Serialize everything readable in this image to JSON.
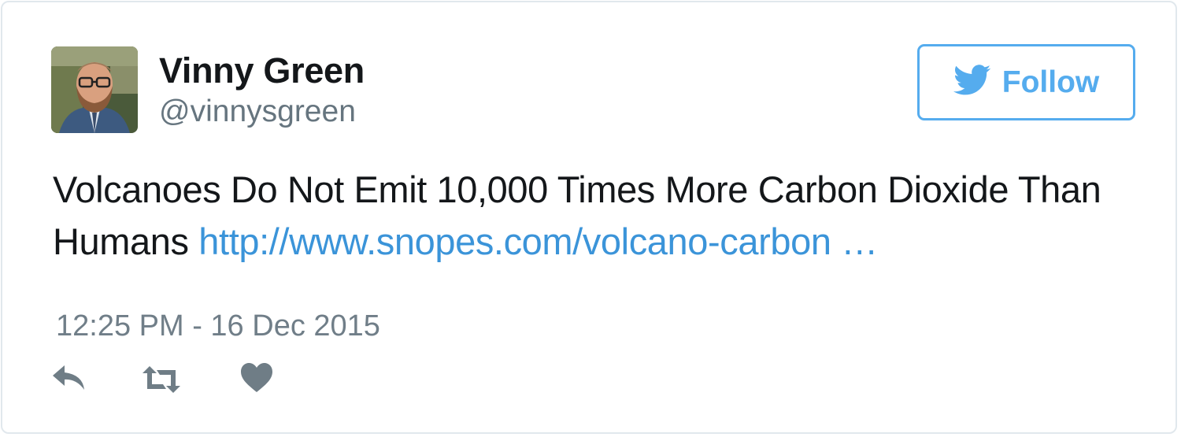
{
  "tweet": {
    "author_name": "Vinny Green",
    "author_handle": "@vinnysgreen",
    "follow_label": "Follow",
    "text": "Volcanoes Do Not Emit 10,000 Times More Carbon Dioxide Than Humans",
    "link_text": "http://www.snopes.com/volcano-carbon …",
    "timestamp": "12:25 PM - 16 Dec 2015"
  },
  "icons": {
    "follow": "twitter-bird-icon",
    "reply": "reply-icon",
    "retweet": "retweet-icon",
    "like": "heart-icon"
  },
  "colors": {
    "twitter_blue": "#55acee",
    "link_blue": "#3b94d9",
    "text_dark": "#14171a",
    "text_muted": "#66757f",
    "icon_gray": "#6f7d86",
    "border": "#e1e8ed"
  }
}
